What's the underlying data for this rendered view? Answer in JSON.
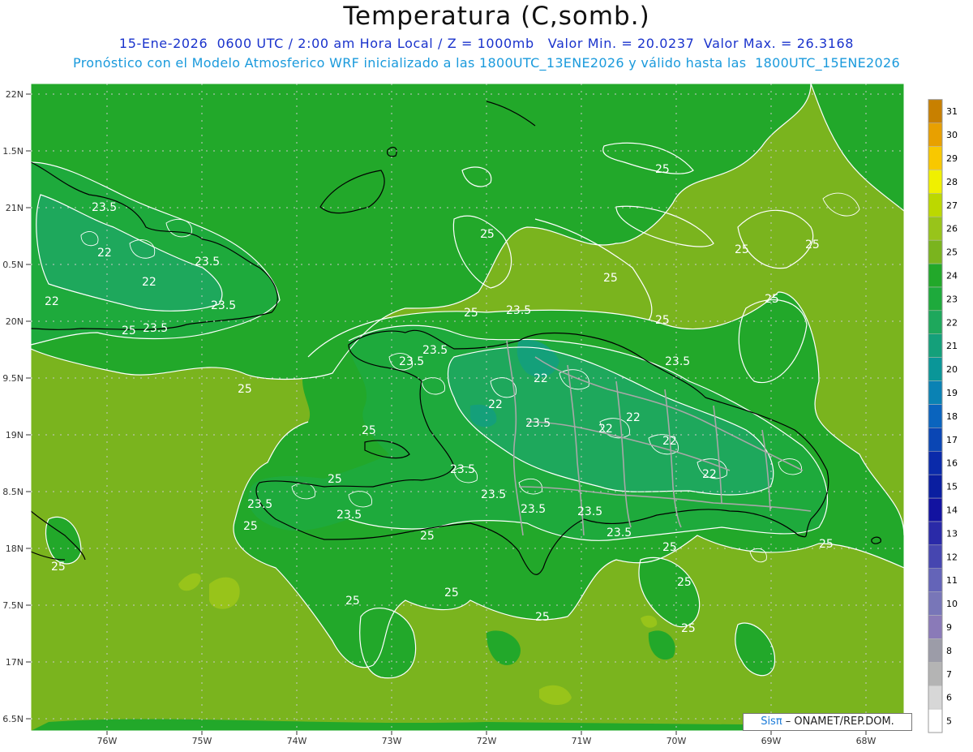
{
  "header": {
    "title": "Temperatura (C,somb.)",
    "line1": "15-Ene-2026  0600 UTC / 2:00 am Hora Local / Z = 1000mb   Valor Min. = 20.0237  Valor Max. = 26.3168",
    "line2": "Pronóstico con el Modelo Atmosferico WRF inicializado a las 1800UTC_13ENE2026 y válido hasta las  1800UTC_15ENE2026"
  },
  "axes": {
    "lat_labels": [
      "22N",
      "1.5N",
      "21N",
      "0.5N",
      "20N",
      "9.5N",
      "19N",
      "8.5N",
      "18N",
      "7.5N",
      "17N",
      "6.5N"
    ],
    "lon_labels": [
      "76W",
      "75W",
      "74W",
      "73W",
      "72W",
      "71W",
      "70W",
      "69W",
      "68W"
    ]
  },
  "colorbar": {
    "levels": [
      "5",
      "6",
      "7",
      "8",
      "9",
      "10",
      "11",
      "12",
      "13",
      "14",
      "15",
      "16",
      "17",
      "18",
      "19",
      "20",
      "21",
      "22",
      "23",
      "24",
      "25",
      "26",
      "27",
      "28",
      "29",
      "30",
      "31"
    ],
    "colors": [
      "#ffffff",
      "#d7d7d7",
      "#b4b4b4",
      "#9c9ca8",
      "#8a7ab8",
      "#7876b8",
      "#6464b8",
      "#4646b0",
      "#2a2aa8",
      "#1212a0",
      "#0a1ea0",
      "#0a2aaa",
      "#0a46b4",
      "#0a64be",
      "#0a82b4",
      "#0a9698",
      "#14a07a",
      "#1ea85c",
      "#1eaa3c",
      "#22a82a",
      "#7ab41e",
      "#98c41a",
      "#bcd800",
      "#f0f000",
      "#f8c800",
      "#e8a000",
      "#c88000"
    ]
  },
  "contour_labels": [
    "23.5",
    "22",
    "23.5",
    "22",
    "22",
    "23.5",
    "25",
    "23.5",
    "25",
    "25",
    "25",
    "25",
    "25",
    "25",
    "23.5",
    "25",
    "23.5",
    "23.5",
    "23.5",
    "22",
    "22",
    "22",
    "23.5",
    "22",
    "22",
    "22",
    "23.5",
    "23.5",
    "23.5",
    "23.5",
    "23.5",
    "25",
    "25",
    "23.5",
    "23.5",
    "25",
    "25",
    "25",
    "25",
    "25",
    "25",
    "25",
    "25",
    "25",
    "25",
    "25",
    "25"
  ],
  "credit": {
    "brand": "Sis",
    "pi": "π",
    "text": " – ONAMET/REP.DOM."
  }
}
